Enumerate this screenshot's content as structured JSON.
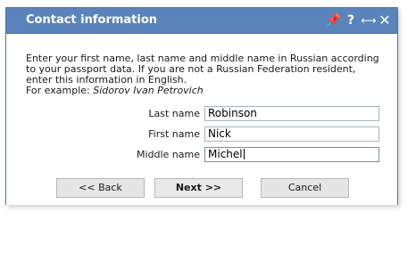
{
  "dialog": {
    "title": "Contact information",
    "icons": [
      "pin-icon",
      "help-icon",
      "expand-icon",
      "close-icon"
    ]
  },
  "intro": {
    "text": "Enter your first name, last name and middle name in Russian according to your passport data. If you are not a Russian Federation resident, enter this information in English.",
    "example_label": "For example: ",
    "example_value": "Sidorov Ivan Petrovich"
  },
  "form": {
    "last_name": {
      "label": "Last name",
      "value": "Robinson"
    },
    "first_name": {
      "label": "First name",
      "value": "Nick"
    },
    "middle_name": {
      "label": "Middle name",
      "value": "Michel"
    }
  },
  "buttons": {
    "back": "<< Back",
    "next": "Next >>",
    "cancel": "Cancel"
  }
}
